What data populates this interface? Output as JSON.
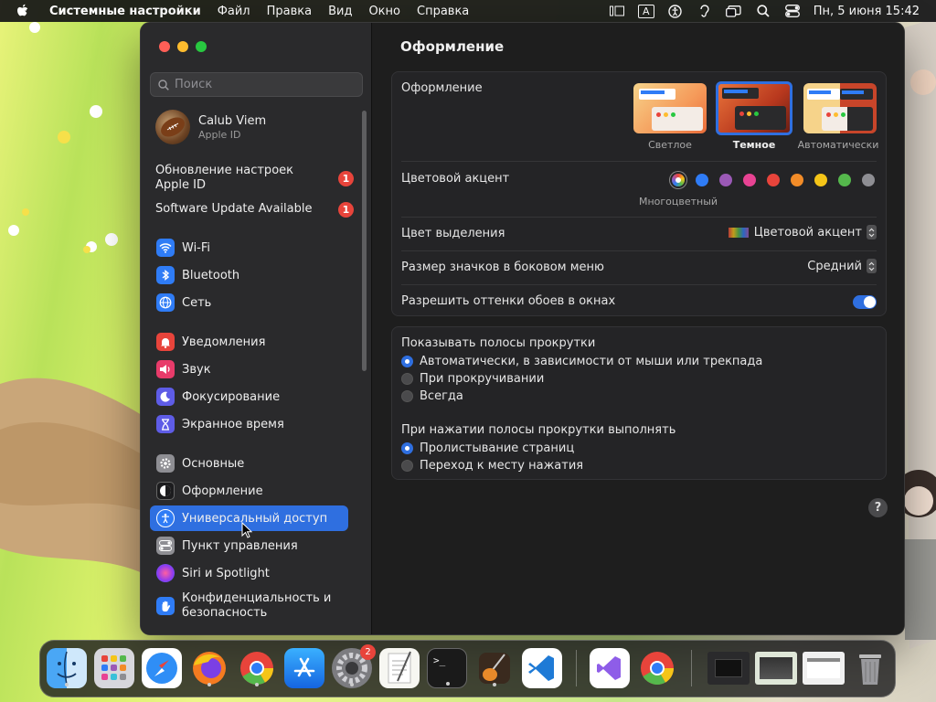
{
  "menubar": {
    "app_name": "Системные настройки",
    "menus": [
      "Файл",
      "Правка",
      "Вид",
      "Окно",
      "Справка"
    ],
    "clock": "Пн, 5 июня  15:42",
    "input_source": "A"
  },
  "sidebar": {
    "search_placeholder": "Поиск",
    "account": {
      "name": "Calub Viem",
      "subtitle": "Apple ID"
    },
    "updates": [
      {
        "label": "Обновление настроек Apple ID",
        "badge": "1"
      },
      {
        "label": "Software Update Available",
        "badge": "1"
      }
    ],
    "items": [
      {
        "label": "Wi-Fi",
        "icon": "wifi-icon",
        "color": "#2f7cf6"
      },
      {
        "label": "Bluetooth",
        "icon": "bluetooth-icon",
        "color": "#2f7cf6"
      },
      {
        "label": "Сеть",
        "icon": "globe-icon",
        "color": "#2f7cf6"
      },
      {
        "label": "Уведомления",
        "icon": "bell-icon",
        "color": "#e8443b"
      },
      {
        "label": "Звук",
        "icon": "speaker-icon",
        "color": "#e83b6a"
      },
      {
        "label": "Фокусирование",
        "icon": "moon-icon",
        "color": "#5e5ce6"
      },
      {
        "label": "Экранное время",
        "icon": "hourglass-icon",
        "color": "#5e5ce6"
      },
      {
        "label": "Основные",
        "icon": "gear-icon",
        "color": "#8e8e93"
      },
      {
        "label": "Оформление",
        "icon": "appearance-icon",
        "color": "#1c1c1e"
      },
      {
        "label": "Универсальный доступ",
        "icon": "accessibility-icon",
        "color": "#2f7cf6"
      },
      {
        "label": "Пункт управления",
        "icon": "control-center-icon",
        "color": "#8e8e93"
      },
      {
        "label": "Siri и Spotlight",
        "icon": "siri-icon",
        "color": "#b23be8"
      },
      {
        "label": "Конфиденциальность и безопасность",
        "icon": "hand-icon",
        "color": "#2f7cf6"
      }
    ]
  },
  "main": {
    "title": "Оформление",
    "appearance": {
      "label": "Оформление",
      "options": [
        {
          "label": "Светлое"
        },
        {
          "label": "Темное",
          "selected": true
        },
        {
          "label": "Автоматически"
        }
      ]
    },
    "accent": {
      "label": "Цветовой акцент",
      "selected_name": "Многоцветный",
      "colors": [
        "multicolor",
        "#2f7cf6",
        "#9b59b6",
        "#e84393",
        "#e8443b",
        "#f28c28",
        "#f5c518",
        "#55b84c",
        "#8e8e93"
      ]
    },
    "highlight": {
      "label": "Цвет выделения",
      "value": "Цветовой акцент"
    },
    "icon_size": {
      "label": "Размер значков в боковом меню",
      "value": "Средний"
    },
    "wallpaper_tint": {
      "label": "Разрешить оттенки обоев в окнах",
      "on": true
    },
    "scrollbars": {
      "label": "Показывать полосы прокрутки",
      "options": [
        {
          "label": "Автоматически, в зависимости от мыши или трекпада",
          "on": true
        },
        {
          "label": "При прокручивании",
          "on": false
        },
        {
          "label": "Всегда",
          "on": false
        }
      ]
    },
    "click_scrollbar": {
      "label": "При нажатии полосы прокрутки выполнять",
      "options": [
        {
          "label": "Пролистывание страниц",
          "on": true
        },
        {
          "label": "Переход к месту нажатия",
          "on": false
        }
      ]
    },
    "help_label": "?"
  },
  "dock": {
    "apps": [
      {
        "name": "Finder",
        "icon": "finder-icon"
      },
      {
        "name": "Launchpad",
        "icon": "launchpad-icon"
      },
      {
        "name": "Safari",
        "icon": "safari-icon"
      },
      {
        "name": "Firefox",
        "icon": "firefox-icon"
      },
      {
        "name": "Chrome",
        "icon": "chrome-icon"
      },
      {
        "name": "App Store",
        "icon": "app-store-icon"
      },
      {
        "name": "System Settings",
        "icon": "system-settings-icon",
        "badge": "2"
      },
      {
        "name": "TextEdit",
        "icon": "textedit-icon"
      },
      {
        "name": "Terminal",
        "icon": "terminal-icon"
      },
      {
        "name": "GarageBand",
        "icon": "garageband-icon"
      },
      {
        "name": "Visual Studio Code",
        "icon": "vscode-icon"
      },
      {
        "name": "Visual Studio",
        "icon": "visual-studio-icon"
      },
      {
        "name": "Chrome",
        "icon": "chrome-icon"
      }
    ],
    "terminal_prompt": ">_"
  }
}
